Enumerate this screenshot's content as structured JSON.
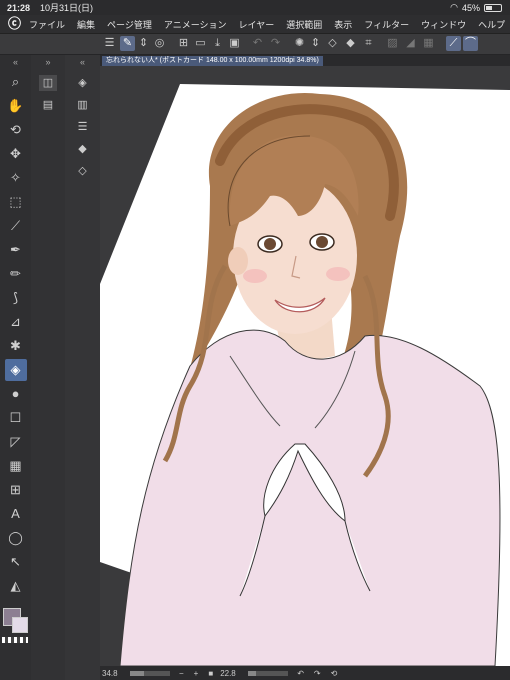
{
  "status": {
    "time": "21:28",
    "date": "10月31日(日)",
    "battery_pct": "45%",
    "battery_fill": 0.45
  },
  "menu": [
    "ファイル",
    "編集",
    "ページ管理",
    "アニメーション",
    "レイヤー",
    "選択範囲",
    "表示",
    "フィルター",
    "ウィンドウ",
    "ヘルプ"
  ],
  "document": {
    "tab_title": "忘れられない人* (ポストカード 148.00 x 100.00mm 1200dpi 34.8%)"
  },
  "bottom": {
    "zoom": "34.8",
    "angle": "22.8",
    "zoom_fraction": 0.35,
    "angle_fraction": 0.2
  },
  "colors": {
    "main": "#8c7f92",
    "sub": "#e3dbe8",
    "accent": "#4f6d9e"
  },
  "tools": [
    "zoom-icon",
    "hand-icon",
    "rotate-icon",
    "move-icon",
    "magic-wand-icon",
    "select-rect-icon",
    "eyedropper-icon",
    "pen-icon",
    "pencil-icon",
    "brush-icon",
    "airbrush-icon",
    "blend-icon",
    "eraser-icon",
    "fill-icon",
    "frame-icon",
    "ruler-icon",
    "gradient-icon",
    "panel-icon",
    "text-icon",
    "balloon-icon",
    "pointer-icon",
    "bucket-icon"
  ]
}
